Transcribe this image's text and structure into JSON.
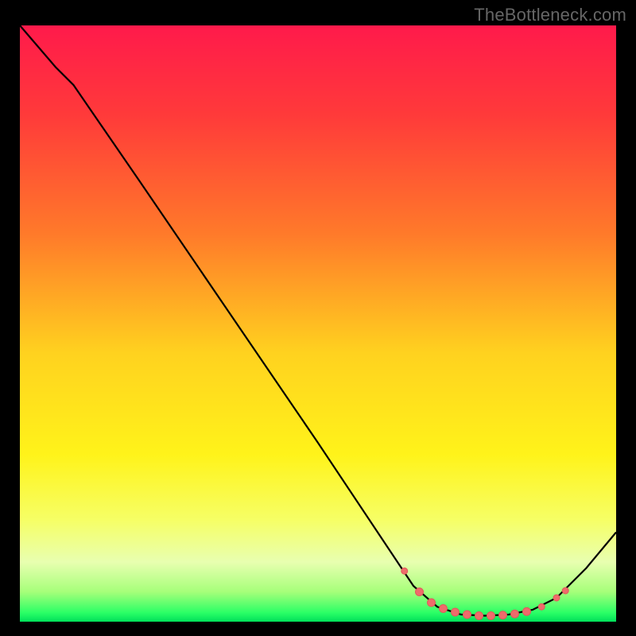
{
  "watermark": "TheBottleneck.com",
  "colors": {
    "background": "#000000",
    "watermark": "#666666",
    "gradient_stops": [
      {
        "offset": 0.0,
        "color": "#ff1a4b"
      },
      {
        "offset": 0.15,
        "color": "#ff3a3a"
      },
      {
        "offset": 0.35,
        "color": "#ff7a2a"
      },
      {
        "offset": 0.55,
        "color": "#ffd21f"
      },
      {
        "offset": 0.72,
        "color": "#fff31a"
      },
      {
        "offset": 0.83,
        "color": "#f6ff66"
      },
      {
        "offset": 0.9,
        "color": "#e8ffb0"
      },
      {
        "offset": 0.95,
        "color": "#a6ff7a"
      },
      {
        "offset": 0.985,
        "color": "#2bff66"
      },
      {
        "offset": 1.0,
        "color": "#00e05a"
      }
    ],
    "curve": "#000000",
    "markers_fill": "#ef6b6b",
    "markers_stroke": "#e05a5a"
  },
  "chart_data": {
    "type": "line",
    "title": "",
    "xlabel": "",
    "ylabel": "",
    "xlim": [
      0,
      100
    ],
    "ylim": [
      0,
      100
    ],
    "grid": false,
    "legend": false,
    "curve": [
      {
        "x": 0,
        "y": 100
      },
      {
        "x": 6,
        "y": 93
      },
      {
        "x": 9,
        "y": 90
      },
      {
        "x": 20,
        "y": 74
      },
      {
        "x": 35,
        "y": 52
      },
      {
        "x": 50,
        "y": 30
      },
      {
        "x": 60,
        "y": 15
      },
      {
        "x": 66,
        "y": 6
      },
      {
        "x": 70,
        "y": 2.5
      },
      {
        "x": 74,
        "y": 1.2
      },
      {
        "x": 78,
        "y": 1.0
      },
      {
        "x": 82,
        "y": 1.2
      },
      {
        "x": 86,
        "y": 2.0
      },
      {
        "x": 90,
        "y": 4.0
      },
      {
        "x": 95,
        "y": 9.0
      },
      {
        "x": 100,
        "y": 15.0
      }
    ],
    "markers": [
      {
        "x": 64.5,
        "y": 8.5,
        "r": 4
      },
      {
        "x": 67,
        "y": 5.0,
        "r": 5
      },
      {
        "x": 69,
        "y": 3.2,
        "r": 5
      },
      {
        "x": 71,
        "y": 2.2,
        "r": 5
      },
      {
        "x": 73,
        "y": 1.6,
        "r": 5
      },
      {
        "x": 75,
        "y": 1.2,
        "r": 5
      },
      {
        "x": 77,
        "y": 1.0,
        "r": 5
      },
      {
        "x": 79,
        "y": 1.0,
        "r": 5
      },
      {
        "x": 81,
        "y": 1.1,
        "r": 5
      },
      {
        "x": 83,
        "y": 1.3,
        "r": 5
      },
      {
        "x": 85,
        "y": 1.7,
        "r": 5
      },
      {
        "x": 87.5,
        "y": 2.5,
        "r": 4
      },
      {
        "x": 90,
        "y": 4.0,
        "r": 4
      },
      {
        "x": 91.5,
        "y": 5.2,
        "r": 4
      }
    ]
  }
}
